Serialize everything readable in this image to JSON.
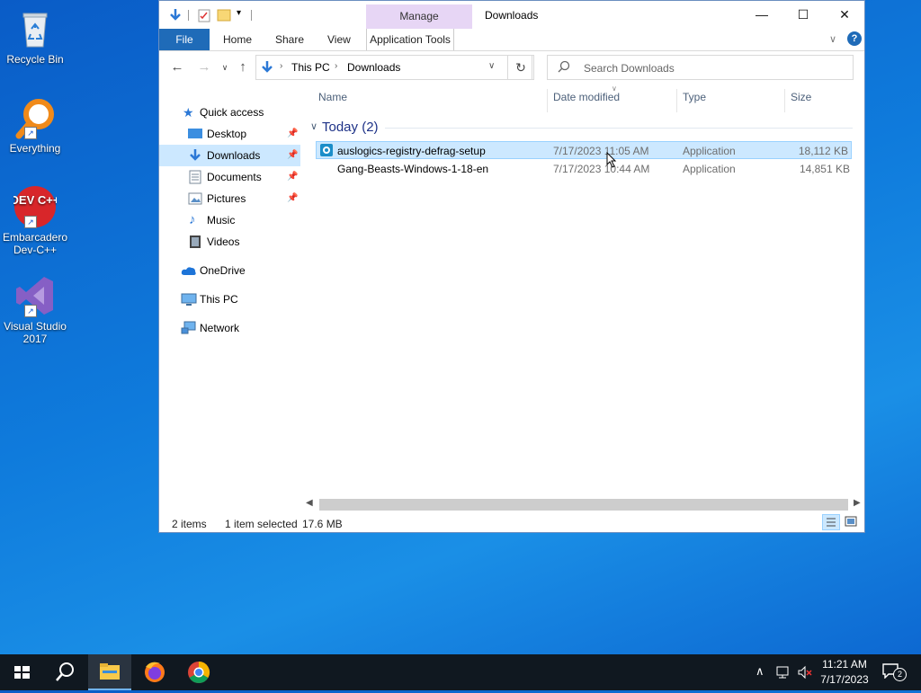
{
  "desktop": {
    "icons": [
      {
        "label": "Recycle Bin",
        "icon": "recycle-bin-icon"
      },
      {
        "label": "Everything",
        "icon": "everything-search-icon"
      },
      {
        "label": "Embarcadero Dev-C++",
        "icon": "devcpp-icon",
        "badge": "DEV C++"
      },
      {
        "label": "Visual Studio 2017",
        "icon": "visual-studio-icon"
      }
    ]
  },
  "window": {
    "title": "Downloads",
    "context_tab": "Manage",
    "ribbon_tabs": {
      "file": "File",
      "home": "Home",
      "share": "Share",
      "view": "View",
      "app_tools": "Application Tools"
    },
    "controls": {
      "minimize": "—",
      "maximize": "☐",
      "close": "✕"
    },
    "address": {
      "root": "This PC",
      "folder": "Downloads"
    },
    "search": {
      "placeholder": "Search Downloads"
    },
    "nav": {
      "quick_access": "Quick access",
      "desktop": "Desktop",
      "downloads": "Downloads",
      "documents": "Documents",
      "pictures": "Pictures",
      "music": "Music",
      "videos": "Videos",
      "onedrive": "OneDrive",
      "this_pc": "This PC",
      "network": "Network"
    },
    "columns": {
      "name": "Name",
      "date": "Date modified",
      "type": "Type",
      "size": "Size"
    },
    "group": "Today (2)",
    "files": [
      {
        "name": "auslogics-registry-defrag-setup",
        "date": "7/17/2023 11:05 AM",
        "type": "Application",
        "size": "18,112 KB",
        "selected": true
      },
      {
        "name": "Gang-Beasts-Windows-1-18-en",
        "date": "7/17/2023 10:44 AM",
        "type": "Application",
        "size": "14,851 KB",
        "selected": false
      }
    ],
    "status": {
      "items": "2 items",
      "selected": "1 item selected",
      "size": "17.6 MB"
    }
  },
  "taskbar": {
    "time": "11:21 AM",
    "date": "7/17/2023",
    "notifications": "2"
  },
  "colors": {
    "accent": "#1f6bb8",
    "selection": "#cce8ff",
    "manage_tab": "#e7d6f5"
  }
}
